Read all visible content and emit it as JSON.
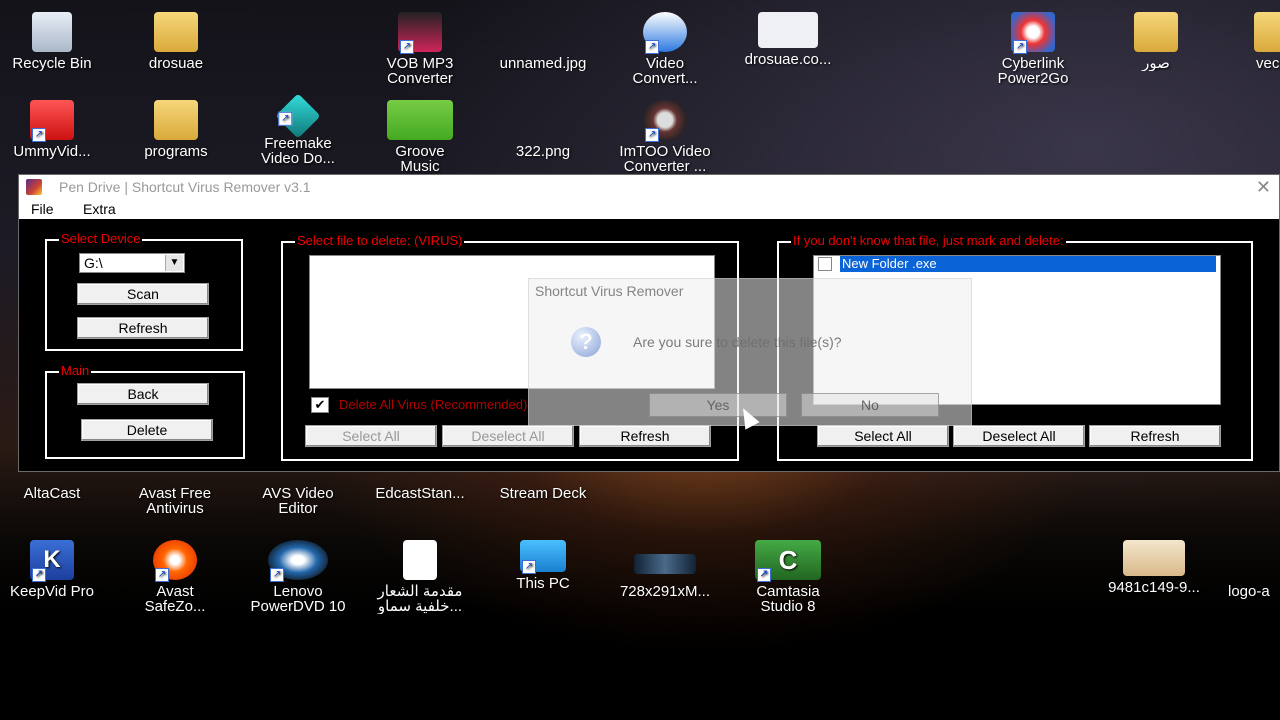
{
  "desktop": {
    "icons_top": [
      {
        "label": "Recycle Bin",
        "icon": "recycle-bin-icon"
      },
      {
        "label": "drosuae",
        "icon": "user-folder-icon"
      },
      {
        "label": "VOB MP3\nConverter",
        "icon": "vob-converter-icon"
      },
      {
        "label": "unnamed.jpg",
        "icon": "image-file-icon"
      },
      {
        "label": "Video\nConvert...",
        "icon": "video-converter-icon"
      },
      {
        "label": "drosuae.co...",
        "icon": "image-file-icon"
      },
      {
        "label": "Cyberlink\nPower2Go",
        "icon": "power2go-icon"
      },
      {
        "label": "صور",
        "icon": "folder-icon"
      },
      {
        "label": "vec",
        "icon": "folder-icon"
      }
    ],
    "icons_row2": [
      {
        "label": "UmmyVid...",
        "icon": "ummy-icon"
      },
      {
        "label": "programs",
        "icon": "folder-icon"
      },
      {
        "label": "Freemake\nVideo Do...",
        "icon": "freemake-icon"
      },
      {
        "label": "Groove\nMusic",
        "icon": "groove-music-icon"
      },
      {
        "label": "322.png",
        "icon": "image-file-icon"
      },
      {
        "label": "ImTOO Video\nConverter ...",
        "icon": "imtoo-icon"
      }
    ],
    "icons_row3": [
      {
        "label": "AltaCast",
        "icon": "altacast-icon"
      },
      {
        "label": "Avast Free\nAntivirus",
        "icon": "avast-icon"
      },
      {
        "label": "AVS Video\nEditor",
        "icon": "avs-icon"
      },
      {
        "label": "EdcastStan...",
        "icon": "edcast-icon"
      },
      {
        "label": "Stream Deck",
        "icon": "stream-deck-icon"
      }
    ],
    "icons_row4": [
      {
        "label": "KeepVid Pro",
        "icon": "keepvid-icon"
      },
      {
        "label": "Avast\nSafeZo...",
        "icon": "avast-safezone-icon"
      },
      {
        "label": "Lenovo\nPowerDVD 10",
        "icon": "powerdvd-icon"
      },
      {
        "label": "مقدمة الشعار\nخلفية سماو...",
        "icon": "document-icon"
      },
      {
        "label": "This PC",
        "icon": "this-pc-icon"
      },
      {
        "label": "728x291xM...",
        "icon": "image-file-icon"
      },
      {
        "label": "Camtasia\nStudio 8",
        "icon": "camtasia-icon"
      },
      {
        "label": "9481c149-9...",
        "icon": "image-file-icon"
      },
      {
        "label": "logo-a",
        "icon": "image-file-icon"
      }
    ]
  },
  "window": {
    "title": "Pen Drive | Shortcut Virus Remover v3.1",
    "close": "✕",
    "menu": [
      "File",
      "Extra"
    ],
    "device_group": {
      "legend": "Select Device",
      "drive_value": "G:\\",
      "scan": "Scan",
      "refresh": "Refresh"
    },
    "main_group": {
      "legend": "Main",
      "back": "Back",
      "delete": "Delete"
    },
    "virus_group": {
      "legend": "Select file to delete: (VIRUS)",
      "checkbox_label": "Delete All Virus (Recommended)",
      "checkbox_checked": "✔",
      "select_all": "Select All",
      "deselect_all": "Deselect All",
      "refresh": "Refresh"
    },
    "unknown_group": {
      "legend": "If you don't know that file, just mark and delete:",
      "items": [
        "New Folder .exe"
      ],
      "select_all": "Select All",
      "deselect_all": "Deselect All",
      "refresh": "Refresh"
    }
  },
  "dialog": {
    "title": "Shortcut Virus Remover",
    "icon_glyph": "?",
    "message": "Are you sure to delete this file(s)?",
    "yes": "Yes",
    "no": "No"
  },
  "colors": {
    "legend_red": "#e00000",
    "selection_blue": "#0a64d8"
  }
}
